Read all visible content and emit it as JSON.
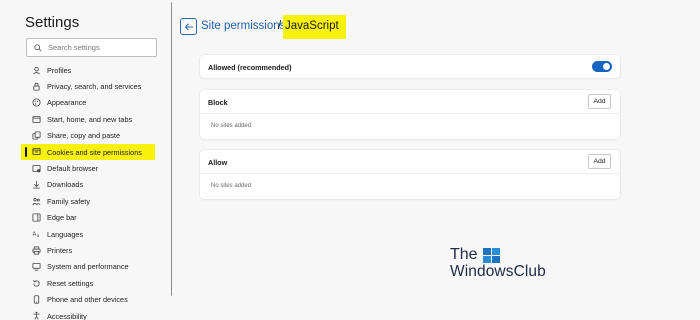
{
  "sidebar": {
    "title": "Settings",
    "search_placeholder": "Search settings",
    "items": [
      {
        "label": "Profiles",
        "icon": "profile-icon"
      },
      {
        "label": "Privacy, search, and services",
        "icon": "lock-icon"
      },
      {
        "label": "Appearance",
        "icon": "appearance-icon"
      },
      {
        "label": "Start, home, and new tabs",
        "icon": "home-icon"
      },
      {
        "label": "Share, copy and paste",
        "icon": "share-icon"
      },
      {
        "label": "Cookies and site permissions",
        "icon": "site-permissions-icon",
        "active": true
      },
      {
        "label": "Default browser",
        "icon": "browser-icon"
      },
      {
        "label": "Downloads",
        "icon": "download-icon"
      },
      {
        "label": "Family safety",
        "icon": "family-icon"
      },
      {
        "label": "Edge bar",
        "icon": "edge-bar-icon"
      },
      {
        "label": "Languages",
        "icon": "languages-icon"
      },
      {
        "label": "Printers",
        "icon": "printer-icon"
      },
      {
        "label": "System and performance",
        "icon": "system-icon"
      },
      {
        "label": "Reset settings",
        "icon": "reset-icon"
      },
      {
        "label": "Phone and other devices",
        "icon": "phone-icon"
      },
      {
        "label": "Accessibility",
        "icon": "accessibility-icon"
      }
    ]
  },
  "main": {
    "breadcrumb": {
      "parent": "Site permissions",
      "separator": "/",
      "current": "JavaScript"
    },
    "allowed": {
      "label": "Allowed (recommended)",
      "enabled": true
    },
    "block": {
      "label": "Block",
      "add_label": "Add",
      "empty_text": "No sites added"
    },
    "allow": {
      "label": "Allow",
      "add_label": "Add",
      "empty_text": "No sites added"
    }
  },
  "watermark": {
    "line1": "The",
    "line2": "WindowsClub"
  },
  "colors": {
    "highlight": "#f7f10c",
    "accent": "#1464c0",
    "link": "#1f5fa8",
    "background": "#f7f7f7"
  }
}
